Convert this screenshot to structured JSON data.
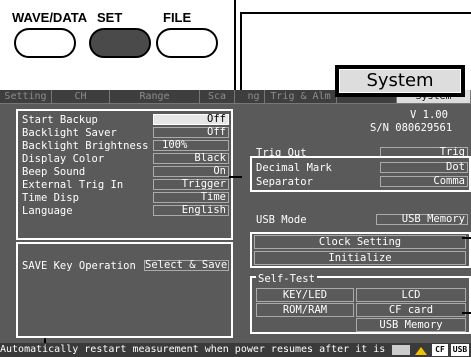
{
  "hw_buttons": {
    "wave_data": "WAVE/DATA",
    "set": "SET",
    "file": "FILE"
  },
  "callout_label": "System",
  "tabs": [
    {
      "label": "Setting"
    },
    {
      "label": "CH"
    },
    {
      "label": "Range"
    },
    {
      "label": "Sca"
    },
    {
      "label": "ng"
    },
    {
      "label": "Trig & Alm"
    },
    {
      "label": ""
    },
    {
      "label": "System"
    }
  ],
  "settings": {
    "start_backup": {
      "label": "Start Backup",
      "value": "Off"
    },
    "backlight_saver": {
      "label": "Backlight Saver",
      "value": "Off"
    },
    "backlight_brightness": {
      "label": "Backlight Brightness",
      "value": "100%"
    },
    "display_color": {
      "label": "Display Color",
      "value": "Black"
    },
    "beep_sound": {
      "label": "Beep Sound",
      "value": "On"
    },
    "external_trig_in": {
      "label": "External Trig In",
      "value": "Trigger"
    },
    "time_disp": {
      "label": "Time Disp",
      "value": "Time"
    },
    "language": {
      "label": "Language",
      "value": "English"
    }
  },
  "save_key": {
    "label": "SAVE Key Operation",
    "value": "Select & Save"
  },
  "version": {
    "version": "V 1.00",
    "serial": "S/N 080629561"
  },
  "trig_out": {
    "label": "Trig Out",
    "value": "Trig"
  },
  "decimal_mark": {
    "label": "Decimal Mark",
    "value": "Dot"
  },
  "separator": {
    "label": "Separator",
    "value": "Comma"
  },
  "usb_mode": {
    "label": "USB Mode",
    "value": "USB Memory"
  },
  "clock_setting": "Clock Setting",
  "initialize": "Initialize",
  "self_test": {
    "title": "Self-Test",
    "key_led": "KEY/LED",
    "lcd": "LCD",
    "rom_ram": "ROM/RAM",
    "cf_card": "CF card",
    "usb_memory": "USB Memory"
  },
  "status_bar": {
    "message": "Automatically restart measurement when power resumes after it is",
    "cf": "CF",
    "usb": "USB"
  }
}
